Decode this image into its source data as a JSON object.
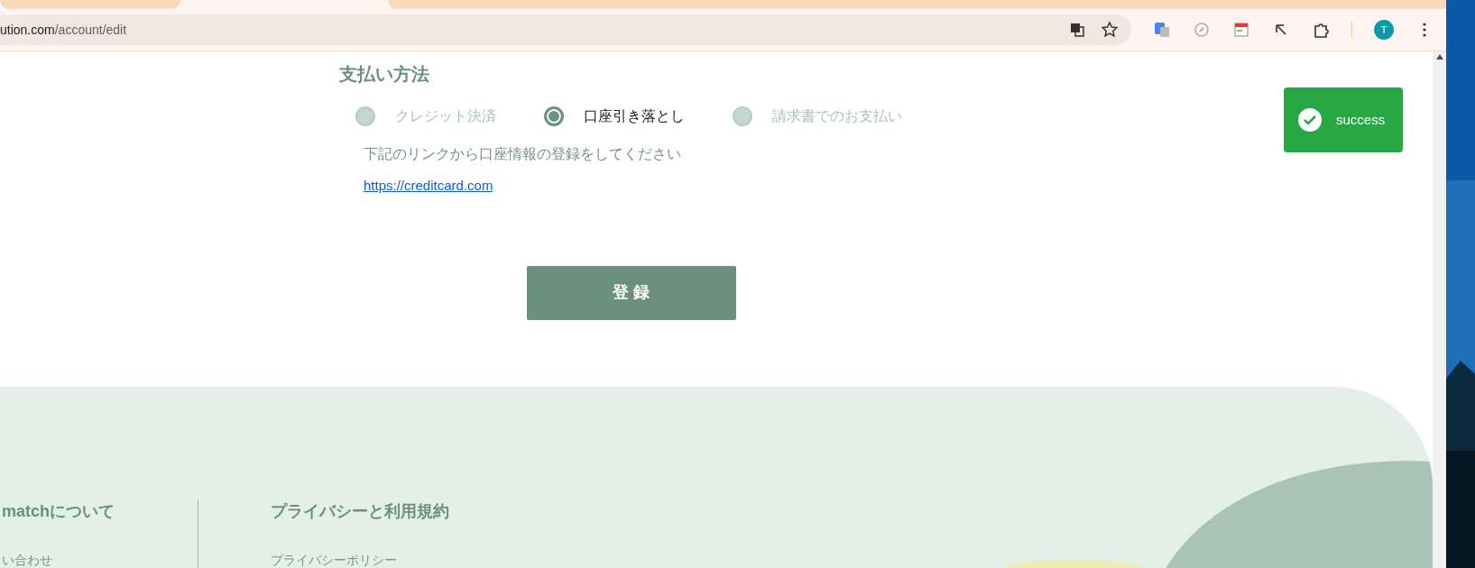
{
  "browser": {
    "url_host": "ution.com",
    "url_path": "/account/edit",
    "avatar": "T"
  },
  "section": {
    "title": "支払い方法",
    "options": [
      {
        "label": "クレジット決済",
        "selected": false
      },
      {
        "label": "口座引き落とし",
        "selected": true
      },
      {
        "label": "請求書でのお支払い",
        "selected": false
      }
    ],
    "instruction": "下記のリンクから口座情報の登録をしてください",
    "link": "https://creditcard.com"
  },
  "submit_button": "登 録",
  "toast": {
    "kind": "success",
    "message": "success"
  },
  "footer": {
    "columns": [
      {
        "title": "matchについて",
        "links": [
          "い合わせ"
        ]
      },
      {
        "title": "プライバシーと利用規約",
        "links": [
          "プライバシーポリシー"
        ]
      }
    ]
  }
}
